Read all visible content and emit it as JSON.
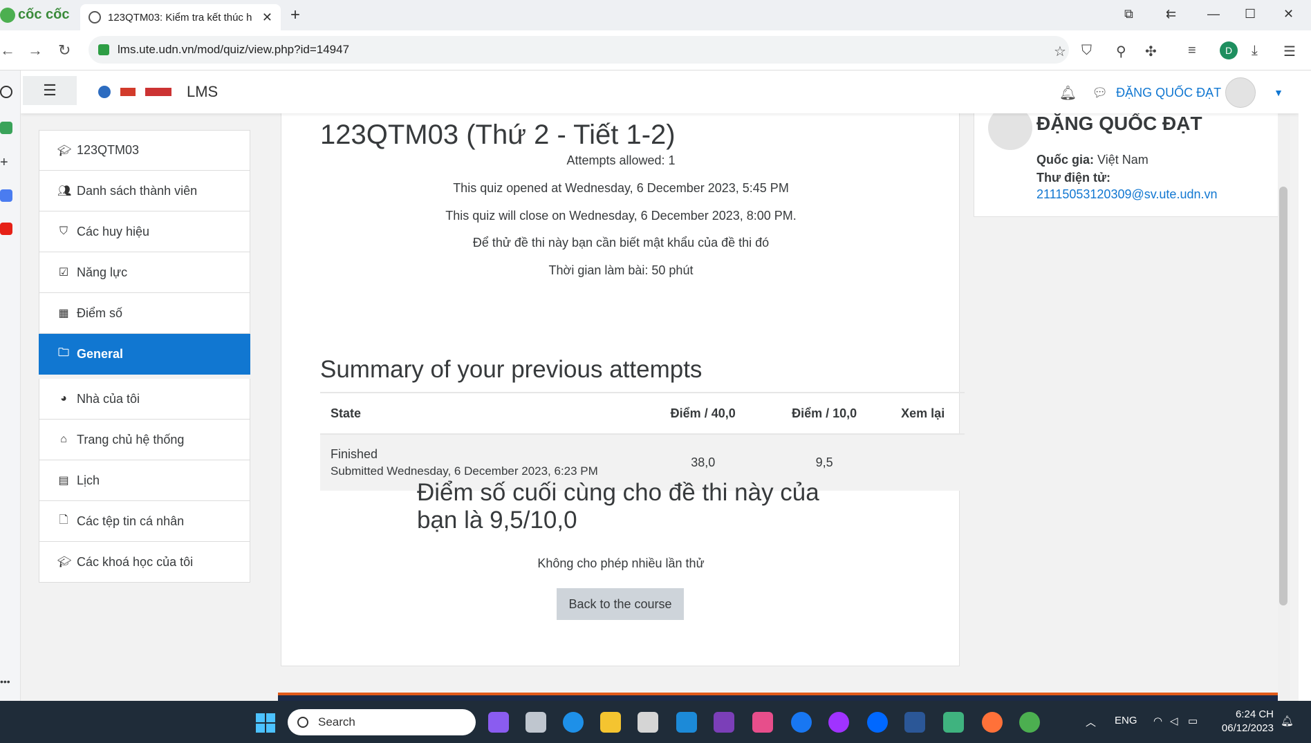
{
  "browser": {
    "brand": "cốc cốc",
    "tab_title": "123QTM03: Kiểm tra kết thúc h",
    "url": "lms.ute.udn.vn/mod/quiz/view.php?id=14947",
    "profile_initial": "D"
  },
  "navbar": {
    "site_name": "LMS",
    "user_name": "ĐẶNG QUỐC ĐẠT"
  },
  "leftnav": {
    "items": [
      {
        "label": "123QTM03",
        "icon": "graduation-cap-icon"
      },
      {
        "label": "Danh sách thành viên",
        "icon": "users-icon"
      },
      {
        "label": "Các huy hiệu",
        "icon": "shield-icon"
      },
      {
        "label": "Năng lực",
        "icon": "checkbox-icon"
      },
      {
        "label": "Điểm số",
        "icon": "table-icon"
      },
      {
        "label": "General",
        "icon": "folder-icon",
        "active": true
      },
      {
        "label": "Nhà của tôi",
        "icon": "dashboard-icon"
      },
      {
        "label": "Trang chủ hệ thống",
        "icon": "home-icon"
      },
      {
        "label": "Lịch",
        "icon": "calendar-icon"
      },
      {
        "label": "Các tệp tin cá nhân",
        "icon": "file-icon"
      },
      {
        "label": "Các khoá học của tôi",
        "icon": "graduation-cap-icon"
      }
    ]
  },
  "quiz": {
    "title": "123QTM03 (Thứ 2 - Tiết 1-2)",
    "attempts_allowed": "Attempts allowed: 1",
    "opened": "This quiz opened at Wednesday, 6 December 2023, 5:45 PM",
    "close": "This quiz will close on Wednesday, 6 December 2023, 8:00 PM.",
    "password_note": "Để thử đề thi này bạn cần biết mật khẩu của đề thi đó",
    "time_limit": "Thời gian làm bài: 50 phút",
    "summary_heading": "Summary of your previous attempts",
    "table": {
      "headers": [
        "State",
        "Điểm / 40,0",
        "Điểm / 10,0",
        "Xem lại"
      ],
      "rows": [
        {
          "state": "Finished",
          "submitted": "Submitted Wednesday, 6 December 2023, 6:23 PM",
          "score40": "38,0",
          "score10": "9,5",
          "review": ""
        }
      ]
    },
    "final_grade": "Điểm số cuối cùng cho đề thi này của bạn là 9,5/10,0",
    "no_multiple": "Không cho phép nhiều lần thử",
    "back_button": "Back to the course"
  },
  "user_block": {
    "name": "ĐẶNG QUỐC ĐẠT",
    "country_label": "Quốc gia:",
    "country_value": "Việt Nam",
    "email_label": "Thư điện tử:",
    "email": "21115053120309@sv.ute.udn.vn"
  },
  "taskbar": {
    "search_placeholder": "Search",
    "lang": "ENG",
    "time": "6:24 CH",
    "date": "06/12/2023"
  }
}
